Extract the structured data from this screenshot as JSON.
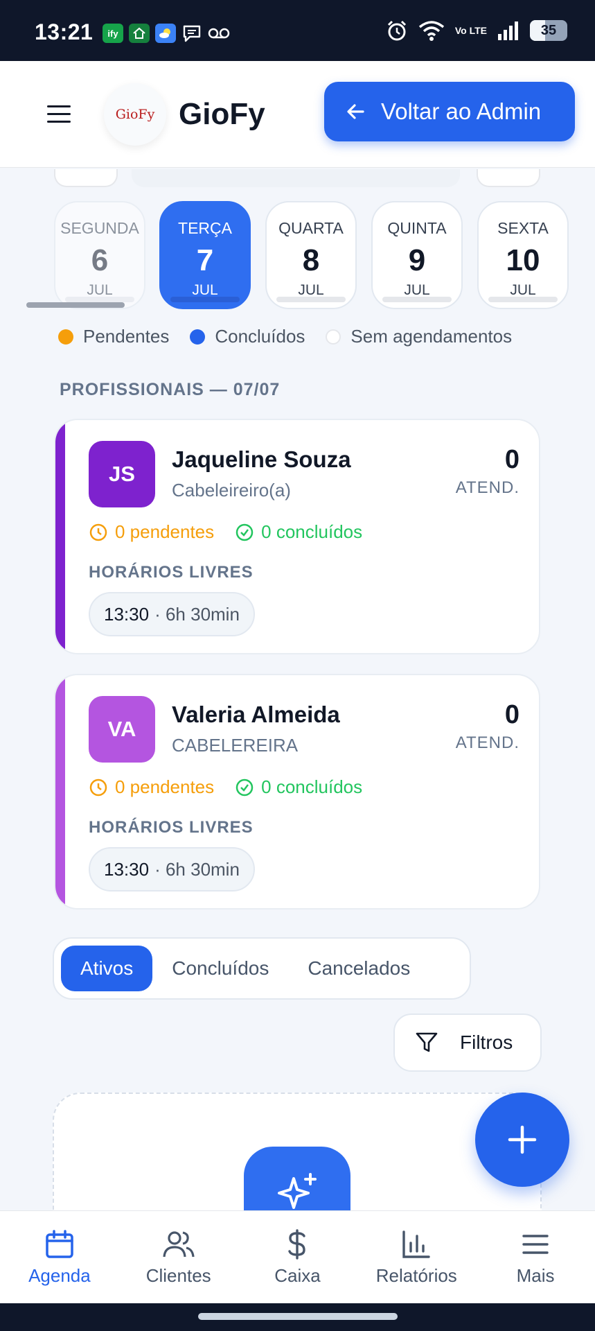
{
  "status_bar": {
    "time": "13:21",
    "apps": [
      "ify",
      "home-app",
      "weather-app",
      "chat-app",
      "voicemail"
    ],
    "volte": "Vo LTE",
    "battery": "35"
  },
  "header": {
    "brand": "GioFy",
    "logo_text": "GioFy",
    "back_button_label": "Voltar ao Admin"
  },
  "days": [
    {
      "name": "SEGUNDA",
      "num": "6",
      "month": "JUL"
    },
    {
      "name": "TERÇA",
      "num": "7",
      "month": "JUL"
    },
    {
      "name": "QUARTA",
      "num": "8",
      "month": "JUL"
    },
    {
      "name": "QUINTA",
      "num": "9",
      "month": "JUL"
    },
    {
      "name": "SEXTA",
      "num": "10",
      "month": "JUL"
    }
  ],
  "legend": {
    "pending": "Pendentes",
    "completed": "Concluídos",
    "none": "Sem agendamentos"
  },
  "section_title": "PROFISSIONAIS — 07/07",
  "professionals": [
    {
      "initials": "JS",
      "name": "Jaqueline Souza",
      "role": "Cabeleireiro(a)",
      "count": "0",
      "count_label": "ATEND.",
      "pending": "0 pendentes",
      "completed": "0 concluídos",
      "free_title": "HORÁRIOS LIVRES",
      "slot_time": "13:30",
      "slot_duration": "· 6h 30min",
      "color": "#7e22ce"
    },
    {
      "initials": "VA",
      "name": "Valeria Almeida",
      "role": "CABELEREIRA",
      "count": "0",
      "count_label": "ATEND.",
      "pending": "0 pendentes",
      "completed": "0 concluídos",
      "free_title": "HORÁRIOS LIVRES",
      "slot_time": "13:30",
      "slot_duration": "· 6h 30min",
      "color": "#b455e0"
    }
  ],
  "status_tabs": [
    "Ativos",
    "Concluídos",
    "Cancelados"
  ],
  "filter_label": "Filtros",
  "bottom_nav": [
    {
      "label": "Agenda",
      "icon": "calendar-icon"
    },
    {
      "label": "Clientes",
      "icon": "users-icon"
    },
    {
      "label": "Caixa",
      "icon": "dollar-icon"
    },
    {
      "label": "Relatórios",
      "icon": "bar-chart-icon"
    },
    {
      "label": "Mais",
      "icon": "menu-icon"
    }
  ],
  "colors": {
    "primary": "#2563eb",
    "pending": "#f59e0b",
    "completed": "#22c55e"
  }
}
